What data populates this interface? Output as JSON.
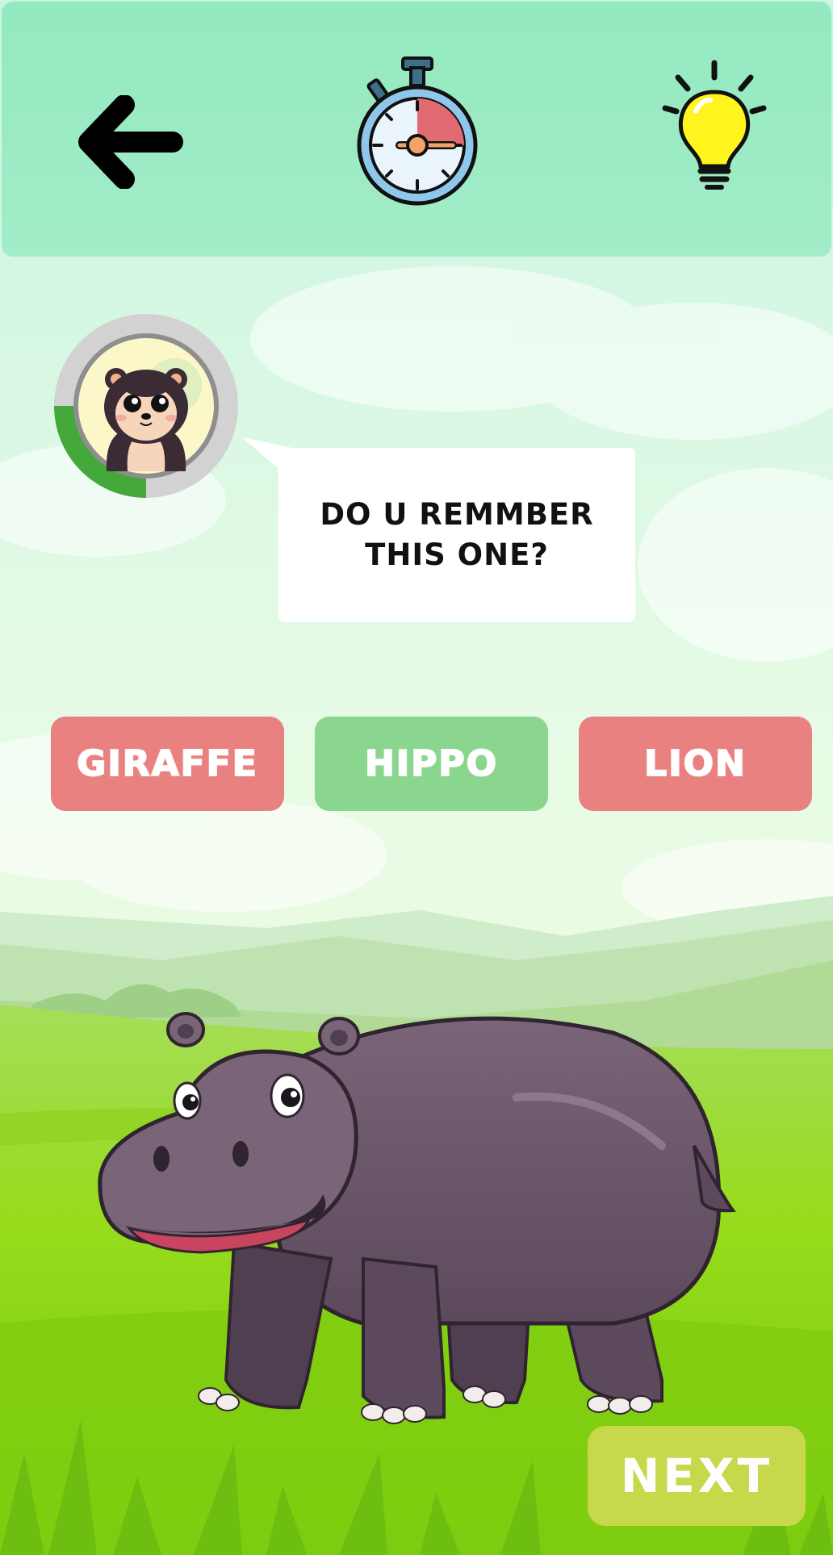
{
  "colors": {
    "topbar": "#93e9c0",
    "wrong_choice": "#e98181",
    "correct_choice": "#8ad68e",
    "next_button": "#c7d94b",
    "timer_progress": "#44a83a"
  },
  "header": {
    "back_icon": "arrow-left-icon",
    "timer_icon": "stopwatch-icon",
    "hint_icon": "lightbulb-icon",
    "timer_remaining_fraction": 0.25
  },
  "character": {
    "avatar_icon": "bear-avatar-icon",
    "progress_fraction": 0.25
  },
  "question": {
    "text": "DO U REMMBER\nTHIS ONE?"
  },
  "choices": [
    {
      "label": "GIRAFFE",
      "state": "wrong"
    },
    {
      "label": "HIPPO",
      "state": "correct"
    },
    {
      "label": "LION",
      "state": "wrong"
    }
  ],
  "next_label": "NEXT"
}
